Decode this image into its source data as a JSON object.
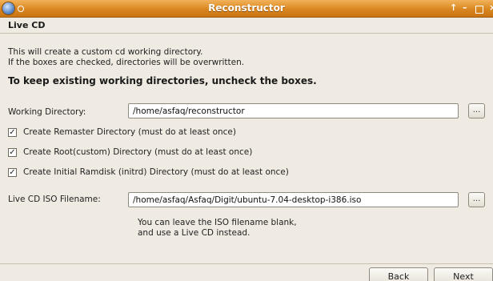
{
  "window": {
    "title": "Reconstructor",
    "controls": {
      "up": "↑",
      "minimize": "–",
      "close": "×"
    }
  },
  "page": {
    "heading": "Live CD",
    "description_line1": "This will create a custom cd working directory.",
    "description_line2": "If the boxes are checked, directories will be overwritten.",
    "warning": "To keep existing working directories, uncheck the boxes."
  },
  "working_directory": {
    "label": "Working Directory:",
    "value": "/home/asfaq/reconstructor",
    "browse_label": "..."
  },
  "checkboxes": [
    {
      "label": "Create Remaster Directory (must do at least once)",
      "checked": true,
      "mark": "✓"
    },
    {
      "label": "Create Root(custom) Directory (must do at least once)",
      "checked": true,
      "mark": "✓"
    },
    {
      "label": "Create Initial Ramdisk (initrd) Directory (must do at least once)",
      "checked": true,
      "mark": "✓"
    }
  ],
  "iso": {
    "label": "Live CD ISO Filename:",
    "value": "/home/asfaq/Asfaq/Digit/ubuntu-7.04-desktop-i386.iso",
    "browse_label": "...",
    "hint_line1": "You can leave the ISO filename blank,",
    "hint_line2": "and use a Live CD instead."
  },
  "navigation": {
    "back_label": "Back",
    "next_label": "Next"
  },
  "colors": {
    "titlebar": "#d9861f",
    "window_bg": "#efebe2",
    "desktop": "#d9c79a"
  }
}
